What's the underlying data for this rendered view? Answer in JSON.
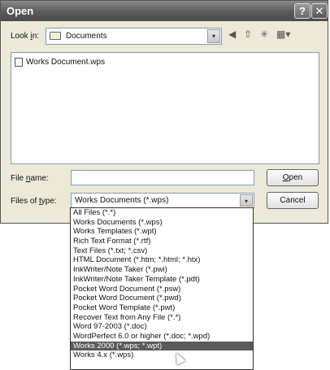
{
  "window": {
    "title": "Open",
    "help_label": "?",
    "close_label": "✕"
  },
  "lookin": {
    "label_pre": "Look ",
    "label_key": "i",
    "label_post": "n:",
    "value": "Documents",
    "arrow": "▾"
  },
  "toolbar": {
    "back_glyph": "◀",
    "up_glyph": "⇧",
    "newfolder_glyph": "✳",
    "views_glyph": "▦▾"
  },
  "files": [
    {
      "name": "Works Document.wps"
    }
  ],
  "filename": {
    "label_pre": "File ",
    "label_key": "n",
    "label_post": "ame:",
    "value": ""
  },
  "filetype": {
    "label_pre": "Files of ",
    "label_key": "t",
    "label_post": "ype:",
    "value": "Works Documents (*.wps)",
    "arrow": "▾"
  },
  "buttons": {
    "open_key": "O",
    "open_rest": "pen",
    "cancel": "Cancel"
  },
  "filetype_options": [
    "All Files (*.*)",
    "Works Documents (*.wps)",
    "Works Templates (*.wpt)",
    "Rich Text Format (*.rtf)",
    "Text Files (*.txt; *.csv)",
    "HTML Document (*.htm; *.html; *.htx)",
    "InkWriter/Note Taker (*.pwi)",
    "InkWriter/Note Taker Template (*.pdt)",
    "Pocket Word Document (*.psw)",
    "Pocket Word Document (*.pwd)",
    "Pocket Word Template (*.pwt)",
    "Recover Text from Any File (*.*)",
    "Word 97-2003 (*.doc)",
    "WordPerfect 6.0 or higher (*.doc; *.wpd)",
    "Works 2000 (*.wps; *.wpt)",
    "Works 4.x (*.wps)"
  ],
  "selected_option_index": 14
}
